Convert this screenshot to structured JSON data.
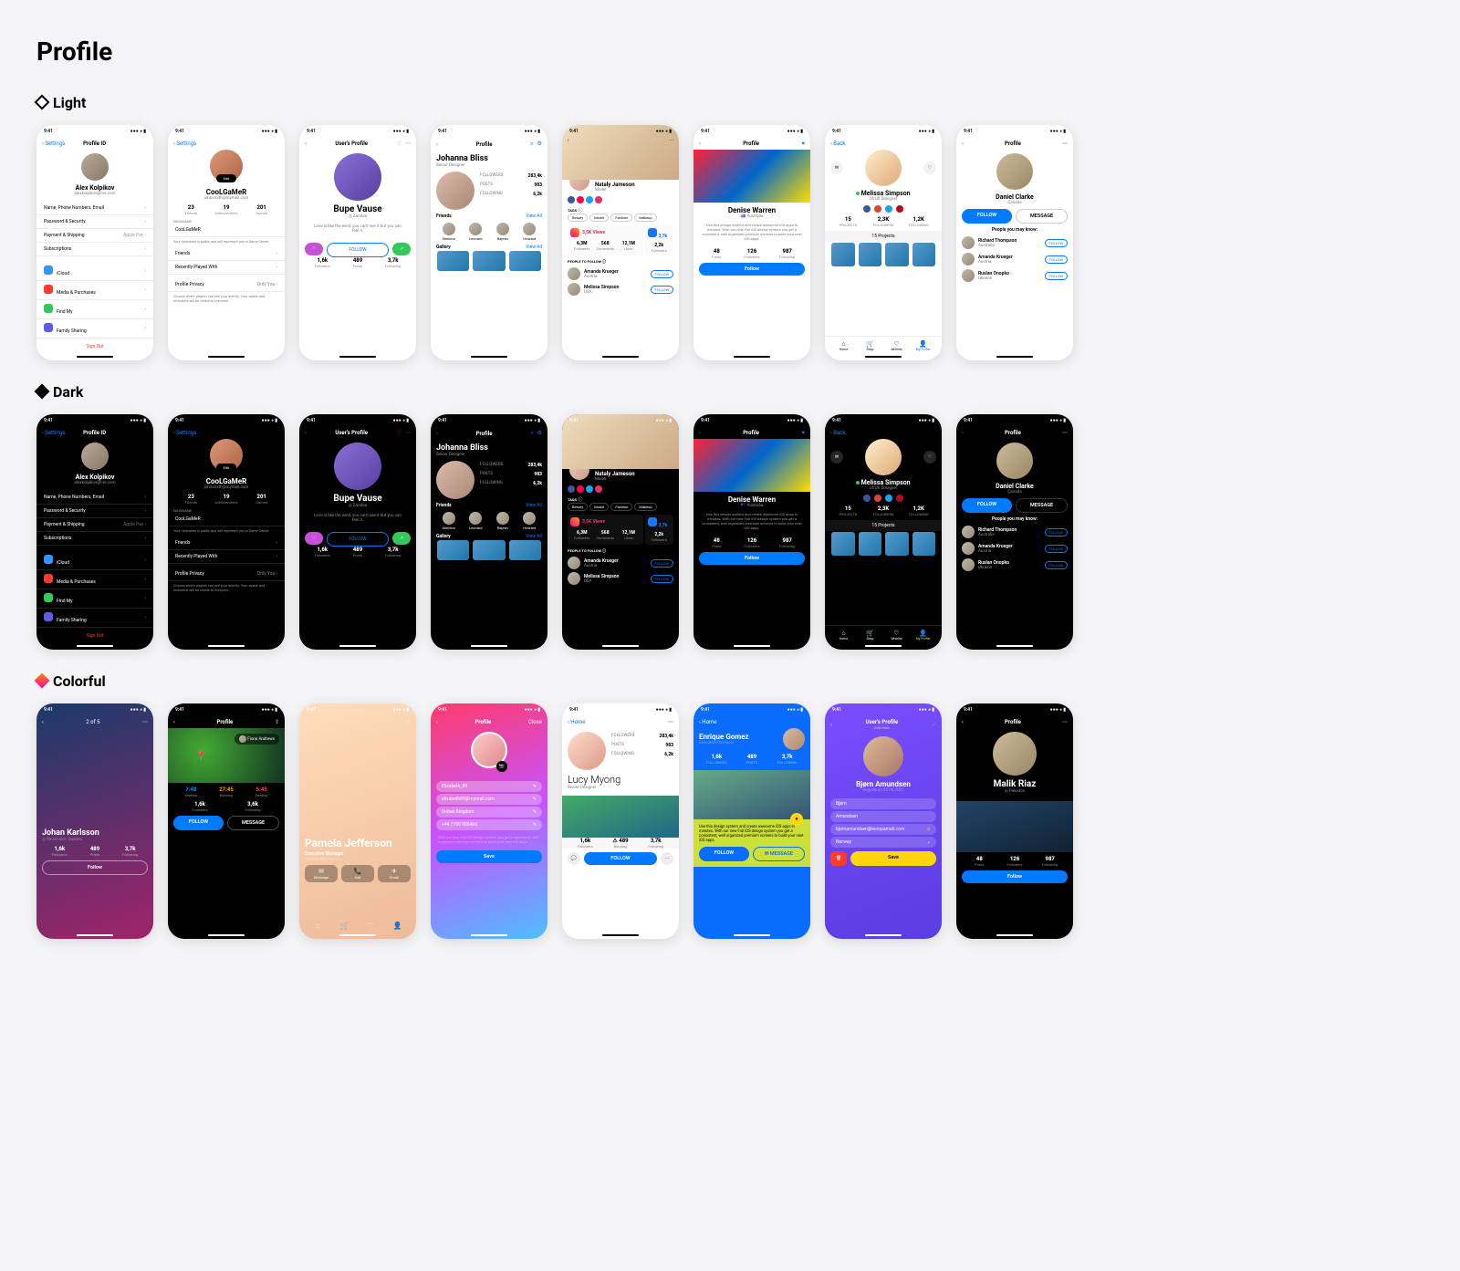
{
  "page_title": "Profile",
  "themes": {
    "light": "Light",
    "dark": "Dark",
    "colorful": "Colorful"
  },
  "status_time": "9:41",
  "nav": {
    "settings": "Settings",
    "back": "Back",
    "close": "Close",
    "home": "Home",
    "profile_id": "Profile ID",
    "users_profile": "User's Profile",
    "profile": "Profile"
  },
  "screens": {
    "s1": {
      "name": "Alex Kolpikov",
      "email": "alexkolpikov@me.com",
      "rows": [
        "Name, Phone Numbers, Email",
        "Password & Security",
        "Payment & Shipping",
        "Subscriptions"
      ],
      "pay": "Apple Pay",
      "apps": [
        "iCloud",
        "Media & Purchases",
        "Find My",
        "Family Sharing"
      ],
      "signout": "Sign Out"
    },
    "s2": {
      "name": "CooLGaMeR",
      "email": "johnsmith@mymail.com",
      "edit": "Edit",
      "stats": [
        {
          "v": "23",
          "l": "Friends"
        },
        {
          "v": "19",
          "l": "Achievements"
        },
        {
          "v": "201",
          "l": "Games"
        }
      ],
      "nickname_label": "NICKNAME",
      "nickname": "CooLGaMeR",
      "nick_hint": "Your nickname is public and will represent you in Game Center.",
      "rows": [
        "Friends",
        "Recently Played With"
      ],
      "privacy": "Profile Privacy",
      "privacy_val": "Only You",
      "priv_hint": "Choose which players can see your activity. Your avatar and nickname will be visible to everyone."
    },
    "s3": {
      "name": "Bupe Vause",
      "loc": "Zambia",
      "quote": "Love is like the wind, you can't see it but you can feel it.",
      "follow": "FOLLOW",
      "stats": [
        {
          "v": "1,6k",
          "l": "Followers"
        },
        {
          "v": "489",
          "l": "Posts"
        },
        {
          "v": "3,7k",
          "l": "Following"
        }
      ]
    },
    "s4": {
      "name": "Johanna Bliss",
      "role": "Senior Designer",
      "stats": [
        {
          "v": "283,4k",
          "l": "FOLLOWERS"
        },
        {
          "v": "983",
          "l": "POSTS"
        },
        {
          "v": "6,2k",
          "l": "FOLLOWING"
        }
      ],
      "friends": "Friends",
      "viewall": "View All",
      "people": [
        "Sheldon",
        "Leonard",
        "Rajesh",
        "Howard"
      ],
      "gallery": "Gallery"
    },
    "s5": {
      "name": "Nataly Jameson",
      "role": "Model",
      "tags_label": "TAGS",
      "tags": [
        "Beauty",
        "Model",
        "Fashion",
        "Makeup"
      ],
      "ig_views": "3,5K Views",
      "fb_count": "3,7k",
      "ig_stats": [
        {
          "v": "6,3M",
          "l": "Followers"
        },
        {
          "v": "568",
          "l": "Comments"
        },
        {
          "v": "12,1M",
          "l": "Likes"
        }
      ],
      "fb_stats": [
        {
          "v": "2,2k",
          "l": "Followers"
        }
      ],
      "ptf": "PEOPLE TO FOLLOW",
      "users": [
        {
          "n": "Amanda Krueger",
          "l": "Austria"
        },
        {
          "n": "Melissa Simpson",
          "l": "USA"
        }
      ],
      "follow": "FOLLOW"
    },
    "s6": {
      "name": "Denise Warren",
      "country": "Australia",
      "desc": "Use this design system and create awesome iOS apps in minutes. With our new Full iOS design system you get a consistent, well organized premium screens to build your next iOS apps.",
      "stats": [
        {
          "v": "48",
          "l": "Posts"
        },
        {
          "v": "126",
          "l": "Followers"
        },
        {
          "v": "987",
          "l": "Following"
        }
      ],
      "follow": "Follow"
    },
    "s7": {
      "name": "Melissa Simpson",
      "role": "UI/UX Designer",
      "online": "Online",
      "stats": [
        {
          "v": "15",
          "l": "PROJECTS"
        },
        {
          "v": "2,3K",
          "l": "FOLLOWERS"
        },
        {
          "v": "1,2K",
          "l": "FOLLOWING"
        }
      ],
      "projects": "15 Projects",
      "tabs": [
        "Home",
        "Shop",
        "Wishlist",
        "My Profile"
      ]
    },
    "s8": {
      "name": "Daniel Clarke",
      "loc": "Canada",
      "follow": "FOLLOW",
      "msg": "MESSAGE",
      "pymi": "People you may know:",
      "users": [
        {
          "n": "Richard Thompson",
          "l": "Australia"
        },
        {
          "n": "Amanda Krueger",
          "l": "Austria"
        },
        {
          "n": "Ruslan Onopko",
          "l": "Ukraine"
        }
      ]
    },
    "c1": {
      "name": "Johan Karlsson",
      "loc": "Stockholm, Sweden",
      "pager": "2 of 5",
      "stats": [
        {
          "v": "1,6k",
          "l": "Followers"
        },
        {
          "v": "489",
          "l": "Posts"
        },
        {
          "v": "3,7k",
          "l": "Following"
        }
      ],
      "follow": "Follow"
    },
    "c2": {
      "name": "Fiona Andrews",
      "workout": [
        {
          "v": "7:48",
          "l": "Walking"
        },
        {
          "v": "27:45",
          "l": "Running"
        },
        {
          "v": "5:45",
          "l": "Resting"
        }
      ],
      "stats": [
        {
          "v": "1,6k",
          "l": "Followers"
        },
        {
          "v": "3,6k",
          "l": "Following"
        }
      ],
      "follow": "FOLLOW",
      "msg": "MESSAGE"
    },
    "c3": {
      "name": "Pamela Jefferson",
      "role": "Executive Manager",
      "loc": "PASADENA, CA, USA",
      "actions": [
        "Message",
        "Call",
        "Email"
      ]
    },
    "c4": {
      "fields": [
        "Elizabeth_89",
        "elizabeth89@mymail.com",
        "United Kingdom",
        "+44 7700 900466"
      ],
      "hint": "With our new Full iOS design system you get a consistent, well organized premium screens to build your next iOS apps.",
      "save": "Save"
    },
    "c5": {
      "name": "Lucy Myong",
      "role": "Senior Designer",
      "stats": [
        {
          "v": "283,4k",
          "l": "FOLLOWERS"
        },
        {
          "v": "983",
          "l": "POSTS"
        },
        {
          "v": "6,2k",
          "l": "FOLLOWING"
        }
      ],
      "stats2": [
        {
          "v": "1,6k",
          "l": "Followers"
        },
        {
          "v": "489",
          "l": "Running"
        },
        {
          "v": "3,7k",
          "l": "Following"
        }
      ],
      "follow": "FOLLOW"
    },
    "c6": {
      "name": "Enrique Gomez",
      "role": "Executive Producer",
      "stats": [
        {
          "v": "1,6k",
          "l": "FOLLOWERS"
        },
        {
          "v": "489",
          "l": "POSTS"
        },
        {
          "v": "3,7k",
          "l": "FOLLOWING"
        }
      ],
      "desc": "Use this design system and create awesome iOS apps in minutes. With our new Full iOS design system you get a consistent, well organized premium screens to build your next iOS apps.",
      "follow": "FOLLOW",
      "msg": "MESSAGE"
    },
    "c7": {
      "name": "Bjørn Amundsen",
      "reg": "Registered 25.06.2021",
      "sub": "Edit Here",
      "fields": [
        "Bjørn",
        "Amundsen",
        "bjornamundsen@europamail.com",
        "Norway"
      ],
      "save": "Save"
    },
    "c8": {
      "name": "Malik Riaz",
      "loc": "Pakistan",
      "stats": [
        {
          "v": "48",
          "l": "Posts"
        },
        {
          "v": "126",
          "l": "Followers"
        },
        {
          "v": "987",
          "l": "Following"
        }
      ],
      "follow": "Follow"
    }
  }
}
